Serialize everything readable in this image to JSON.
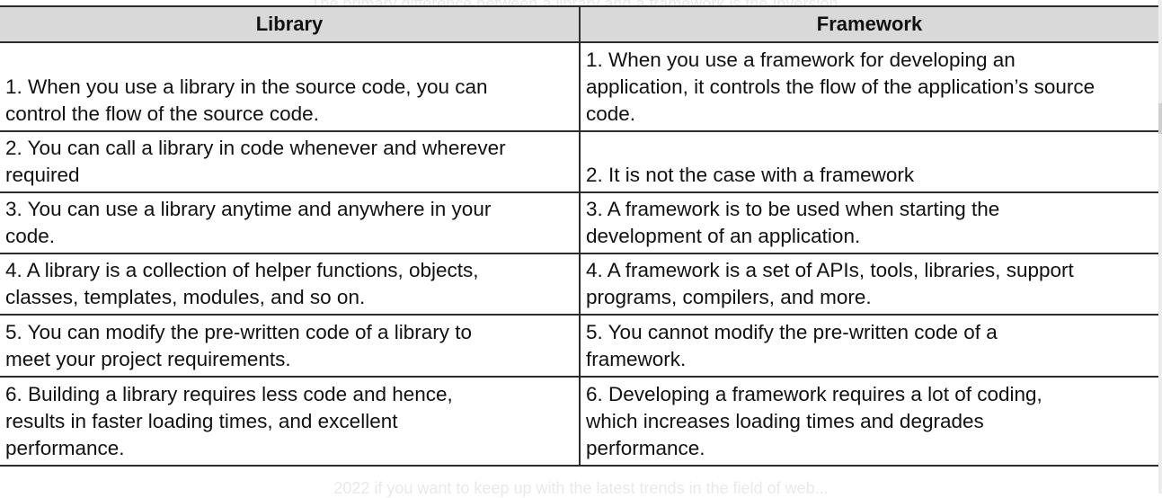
{
  "background_text": {
    "top": "The primary difference between a library and a framework is the Inversion...",
    "bottom": "2022 if you want to keep up with the latest trends in the field of web..."
  },
  "table": {
    "headers": [
      "Library",
      "Framework"
    ],
    "rows": [
      {
        "library": [
          "1. When you use a library in the source code, you can",
          "control the flow of the source code."
        ],
        "framework": [
          "1. When you use a framework for developing an",
          "application, it controls the flow of the application’s source",
          "code."
        ]
      },
      {
        "library": [
          "2. You can call a library in code whenever and wherever",
          "required"
        ],
        "framework": [
          "2. It is not the case with a framework"
        ]
      },
      {
        "library": [
          "3. You can use a library anytime and anywhere in your",
          "code."
        ],
        "framework": [
          "3. A framework is to be used when starting the",
          "development of an application."
        ]
      },
      {
        "library": [
          "4. A library is a collection of helper functions, objects,",
          "classes, templates, modules, and so on."
        ],
        "framework": [
          "4. A framework is a set of APIs, tools, libraries, support",
          "programs, compilers, and more."
        ]
      },
      {
        "library": [
          "5. You can modify the pre-written code of a library to",
          "meet your project requirements."
        ],
        "framework": [
          "5. You cannot modify the pre-written code of a",
          "framework."
        ]
      },
      {
        "library": [
          "6. Building a library requires less code and hence,",
          "results in faster loading times, and excellent",
          "performance."
        ],
        "framework": [
          "6. Developing a framework requires a lot of coding,",
          "which increases loading times and degrades",
          "performance."
        ]
      }
    ]
  },
  "colors": {
    "header_bg": "#d9d9d9",
    "border": "#2b2b2b",
    "text": "#111111",
    "ghost_text": "#e9e9e9"
  }
}
